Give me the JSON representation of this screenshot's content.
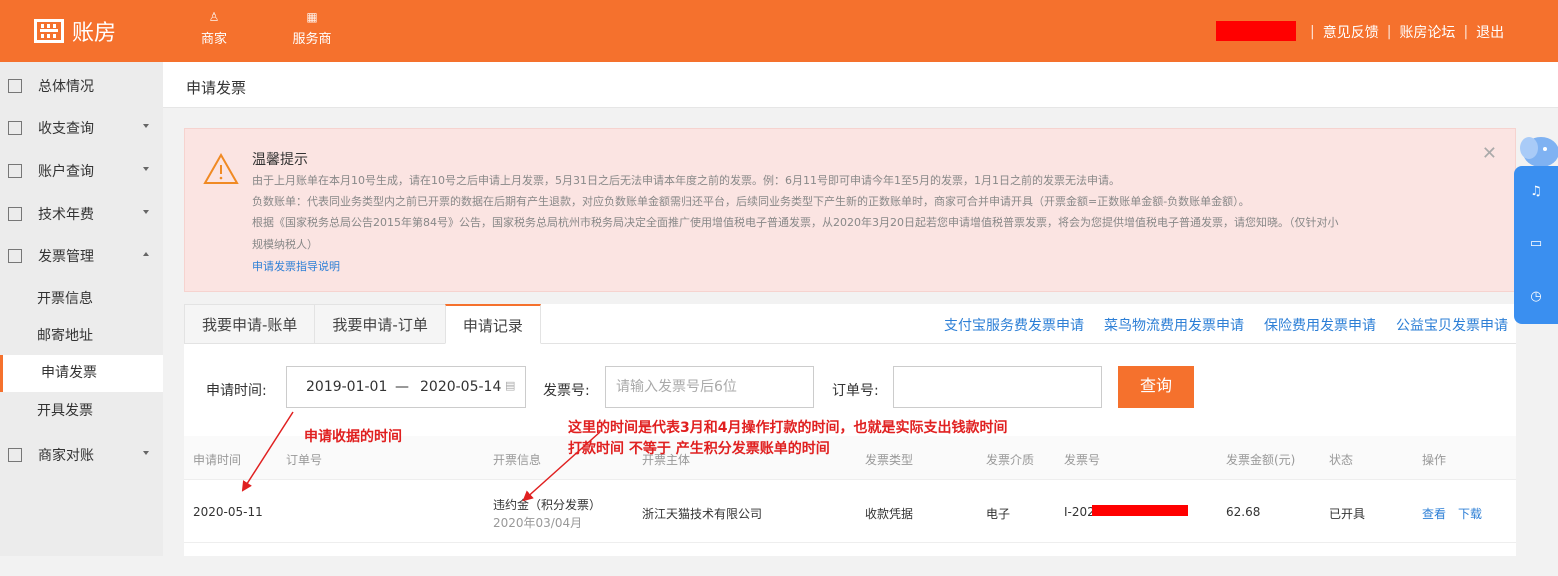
{
  "header": {
    "logo_text": "账房",
    "nav": [
      {
        "label": "商家",
        "icon": "user-icon"
      },
      {
        "label": "服务商",
        "icon": "grid-icon"
      }
    ],
    "links": [
      "意见反馈",
      "账房论坛",
      "退出"
    ],
    "brand_color": "#f5712d"
  },
  "sidebar": {
    "items": [
      {
        "label": "总体情况",
        "icon": "overview-icon"
      },
      {
        "label": "收支查询",
        "icon": "search-doc-icon"
      },
      {
        "label": "账户查询",
        "icon": "building-icon"
      },
      {
        "label": "技术年费",
        "icon": "building-icon"
      },
      {
        "label": "发票管理",
        "icon": "invoice-icon"
      },
      {
        "label": "商家对账",
        "icon": "invoice-icon"
      }
    ],
    "subitems": [
      "开票信息",
      "邮寄地址",
      "申请发票",
      "开具发票"
    ],
    "active_sub": "申请发票"
  },
  "page": {
    "title": "申请发票"
  },
  "alert": {
    "title": "温馨提示",
    "lines": [
      "由于上月账单在本月10号生成，请在10号之后申请上月发票，5月31日之后无法申请本年度之前的发票。例：6月11号即可申请今年1至5月的发票，1月1日之前的发票无法申请。",
      "负数账单：代表同业务类型内之前已开票的数据在后期有产生退款，对应负数账单金额需归还平台，后续同业务类型下产生新的正数账单时，商家可合并申请开具（开票金额=正数账单金额-负数账单金额）。",
      "根据《国家税务总局公告2015年第84号》公告，国家税务总局杭州市税务局决定全面推广使用增值税电子普通发票，从2020年3月20日起若您申请增值税普票发票，将会为您提供增值税电子普通发票，请您知晓。（仅针对小",
      "规模纳税人）"
    ],
    "link": "申请发票指导说明"
  },
  "tabs": [
    "我要申请-账单",
    "我要申请-订单",
    "申请记录"
  ],
  "right_links": [
    "支付宝服务费发票申请",
    "菜鸟物流费用发票申请",
    "保险费用发票申请",
    "公益宝贝发票申请"
  ],
  "filters": {
    "time_label": "申请时间:",
    "date_from": "2019-01-01",
    "date_sep": "—",
    "date_to": "2020-05-14",
    "invoice_label": "发票号:",
    "invoice_placeholder": "请输入发票号后6位",
    "order_label": "订单号:",
    "query_button": "查询"
  },
  "table": {
    "columns": [
      "申请时间",
      "订单号",
      "开票信息",
      "开票主体",
      "发票类型",
      "发票介质",
      "发票号",
      "发票金额(元)",
      "状态",
      "操作"
    ],
    "rows": [
      {
        "apply_time": "2020-05-11",
        "order_no": "",
        "info": "违约金（积分发票）",
        "info_sub": "2020年03/04月",
        "entity": "浙江天猫技术有限公司",
        "type": "收款凭据",
        "medium": "电子",
        "invoice_no": "I-202",
        "amount": "62.68",
        "status": "已开具",
        "actions": [
          "查看",
          "下载"
        ]
      }
    ]
  },
  "annotations": {
    "a1": "申请收据的时间",
    "a2": "这里的时间是代表3月和4月操作打款的时间，也就是实际支出钱款时间",
    "a3": "打款时间  不等于   产生积分发票账单的时间"
  }
}
